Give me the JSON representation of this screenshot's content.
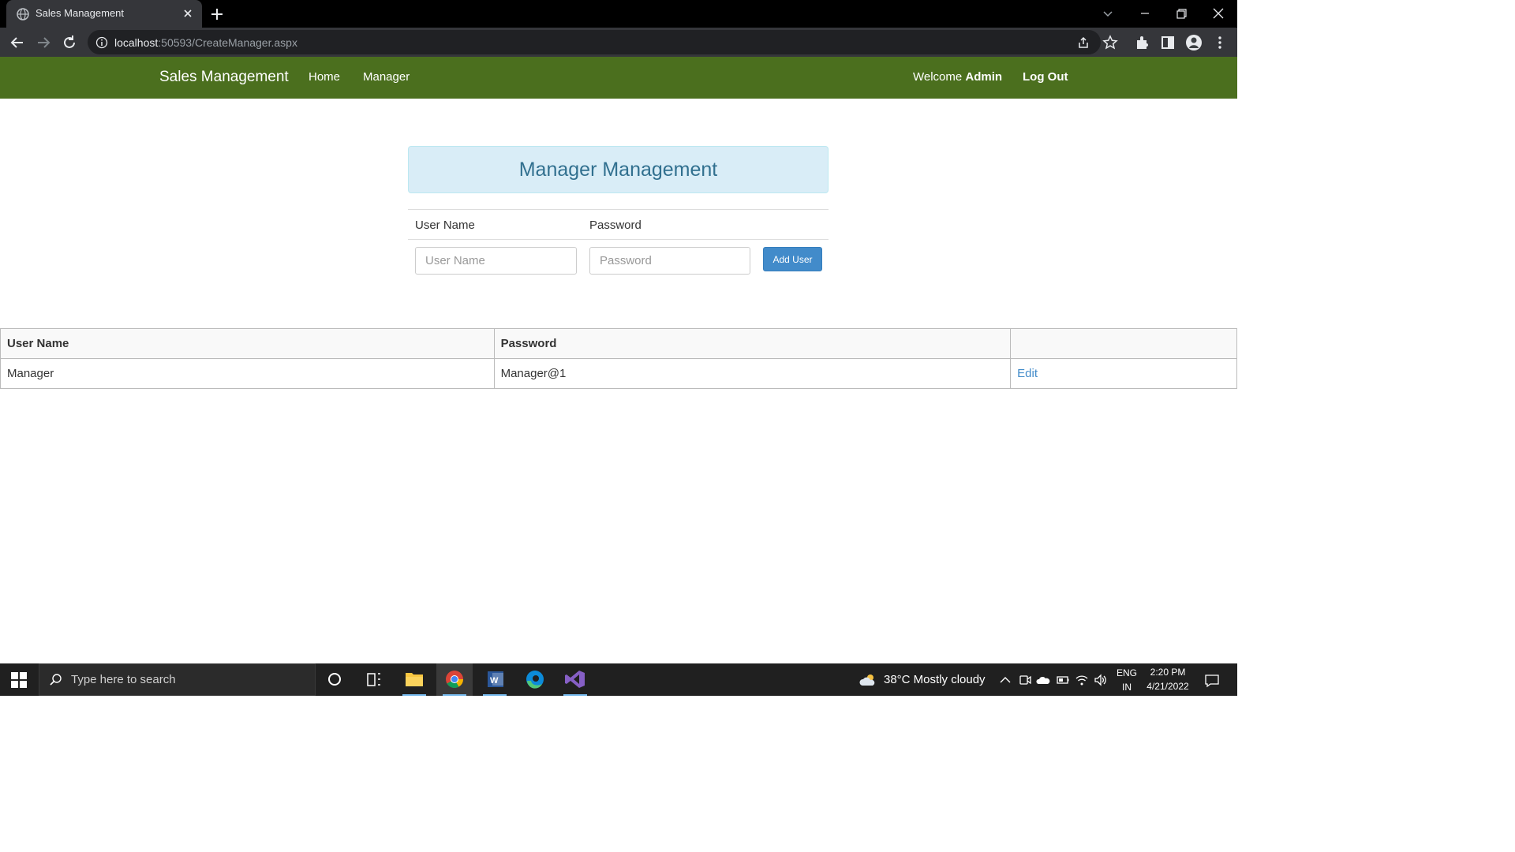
{
  "browser": {
    "tab_title": "Sales Management",
    "url_host": "localhost",
    "url_path": ":50593/CreateManager.aspx"
  },
  "navbar": {
    "brand": "Sales Management",
    "links": [
      "Home",
      "Manager"
    ],
    "welcome_prefix": "Welcome",
    "welcome_user": "Admin",
    "logout": "Log Out",
    "color": "#4b6f1e"
  },
  "panel": {
    "title": "Manager Management"
  },
  "form": {
    "username_label": "User Name",
    "password_label": "Password",
    "username_placeholder": "User Name",
    "password_placeholder": "Password",
    "username_value": "",
    "password_value": "",
    "add_button": "Add User"
  },
  "grid": {
    "headers": [
      "User Name",
      "Password",
      ""
    ],
    "rows": [
      {
        "user_name": "Manager",
        "password": "Manager@1",
        "action": "Edit"
      }
    ]
  },
  "taskbar": {
    "search_placeholder": "Type here to search",
    "weather": "38°C  Mostly cloudy",
    "lang_top": "ENG",
    "lang_bottom": "IN",
    "time": "2:20 PM",
    "date": "4/21/2022",
    "apps": [
      "file-explorer-icon",
      "chrome-icon",
      "word-icon",
      "edge-icon",
      "visual-studio-icon"
    ]
  }
}
